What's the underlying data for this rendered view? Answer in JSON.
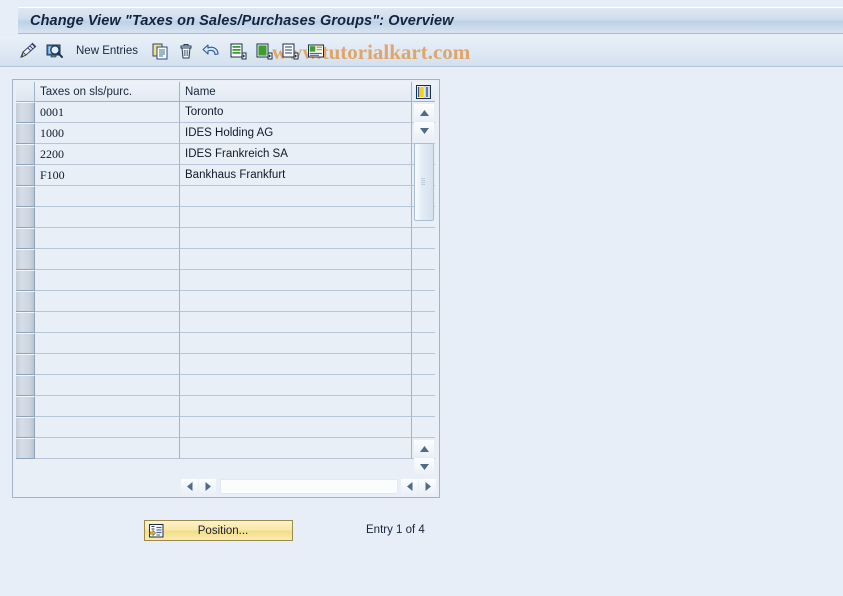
{
  "window": {
    "title": "Change View \"Taxes on Sales/Purchases Groups\": Overview"
  },
  "watermark": {
    "text": "www.tutorialkart.com",
    "color": "#e0a060"
  },
  "toolbar": {
    "new_entries_label": "New Entries",
    "buttons": [
      {
        "name": "display-change-icon",
        "title": "Display/Change"
      },
      {
        "name": "details-magnifier-icon",
        "title": "Details"
      },
      {
        "name": "copy-icon",
        "title": "Copy As..."
      },
      {
        "name": "delete-trash-icon",
        "title": "Delete"
      },
      {
        "name": "undo-arrow-icon",
        "title": "Undo Change"
      },
      {
        "name": "select-all-icon",
        "title": "Select All"
      },
      {
        "name": "select-block-icon",
        "title": "Select Block"
      },
      {
        "name": "deselect-all-icon",
        "title": "Deselect All"
      },
      {
        "name": "variant-list-icon",
        "title": "Choose Variant"
      }
    ]
  },
  "table": {
    "columns": [
      {
        "key": "code",
        "label": "Taxes on sls/purc."
      },
      {
        "key": "name",
        "label": "Name"
      }
    ],
    "rows": [
      {
        "code": "0001",
        "name": "Toronto"
      },
      {
        "code": "1000",
        "name": "IDES Holding AG"
      },
      {
        "code": "2200",
        "name": "IDES Frankreich SA"
      },
      {
        "code": "F100",
        "name": "Bankhaus Frankfurt"
      }
    ],
    "empty_row_count": 13,
    "config_icon": "table-settings-icon"
  },
  "scrollbars": {
    "vertical": {
      "up_icon": "triangle-up-icon",
      "down_icon": "triangle-down-icon",
      "bottom_up_icon": "triangle-up-icon",
      "bottom_down_icon": "triangle-down-icon"
    },
    "horizontal": {
      "left_icon": "triangle-left-icon",
      "right_icon": "triangle-right-icon",
      "left_icon_2": "triangle-left-icon",
      "right_icon_2": "triangle-right-icon"
    }
  },
  "footer": {
    "position_button_label": "Position...",
    "position_button_icon": "position-list-icon",
    "entry_status": "Entry 1 of 4"
  }
}
